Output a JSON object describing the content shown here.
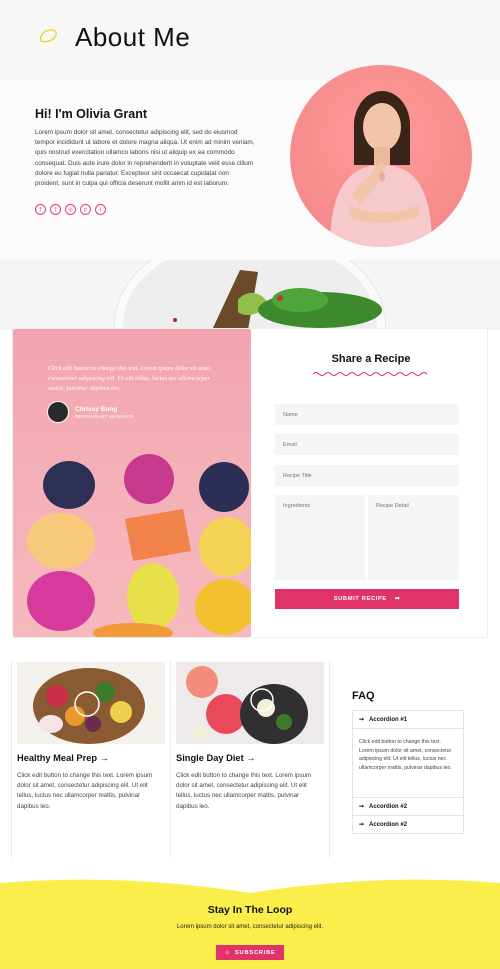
{
  "header": {
    "title": "About Me",
    "logo_icon": "lemon-icon"
  },
  "intro": {
    "heading": "Hi! I'm Olivia Grant",
    "paragraph": "Lorem ipsum dolor sit amet, consectetur adipiscing elit, sed do eiusmod tempor incididunt ut labore et dolore magna aliqua. Ut enim ad minim veniam, quis nostrud exercitation ullamco laboris nisi ut aliquip ex ea commodo consequat. Duis aute irure dolor in reprehenderit in voluptate velit esse cillum dolore eu fugiat nulla pariatur. Excepteur sint occaecat cupidatat non proident, sunt in culpa qui officia deserunt mollit anim id est laborum.",
    "social": [
      {
        "icon": "facebook-icon",
        "glyph": "f"
      },
      {
        "icon": "twitter-icon",
        "glyph": "t"
      },
      {
        "icon": "instagram-icon",
        "glyph": "◎"
      },
      {
        "icon": "pinterest-icon",
        "glyph": "p"
      },
      {
        "icon": "tumblr-icon",
        "glyph": "t"
      }
    ]
  },
  "testimonial": {
    "quote": "Click edit button to change this text. Lorem ipsum dolor sit amet, consectetur adipiscing elit. Ut elit tellus, luctus nec ullamcorper mattis, pulvinar dapibus leo.",
    "name": "Chrissy Bong",
    "role": "RESTAURANT MANAGER"
  },
  "share_form": {
    "title": "Share a Recipe",
    "name_placeholder": "Name",
    "email_placeholder": "Email",
    "recipe_title_placeholder": "Recipe Title",
    "ingredients_placeholder": "Ingredients",
    "detail_placeholder": "Recipe Detail",
    "submit_label": "SUBMIT RECIPE"
  },
  "cards": [
    {
      "title": "Healthy Meal Prep →",
      "text": "Click edit button to change this text. Lorem ipsum dolor sit amet, consectetur adipiscing elit. Ut elit tellus, luctus nec ullamcorper mattis, pulvinar dapibus leo."
    },
    {
      "title": "Single Day Diet →",
      "text": "Click edit button to change this text. Lorem ipsum dolor sit amet, consectetur adipiscing elit. Ut elit tellus, luctus nec ullamcorper mattis, pulvinar dapibus leo."
    }
  ],
  "faq": {
    "title": "FAQ",
    "items": [
      {
        "label": "Accordion #1",
        "body": "Click edit button to change this text. Lorem ipsum dolor sit amet, consectetur adipiscing elit. Ut elit tellus, luctus nec ullamcorper mattis, pulvinar dapibus leo."
      },
      {
        "label": "Accordion #2"
      },
      {
        "label": "Accordion #2"
      }
    ]
  },
  "newsletter": {
    "title": "Stay In The Loop",
    "text": "Lorem ipsum dolor sit amet, consectetur adipiscing elit.",
    "button_label": "SUBSCRIBE"
  },
  "colors": {
    "accent": "#e0336a",
    "pink_panel": "#f4b0b7",
    "newsletter_bg": "#fcee4a",
    "portrait_bg": "#f58b8b"
  }
}
